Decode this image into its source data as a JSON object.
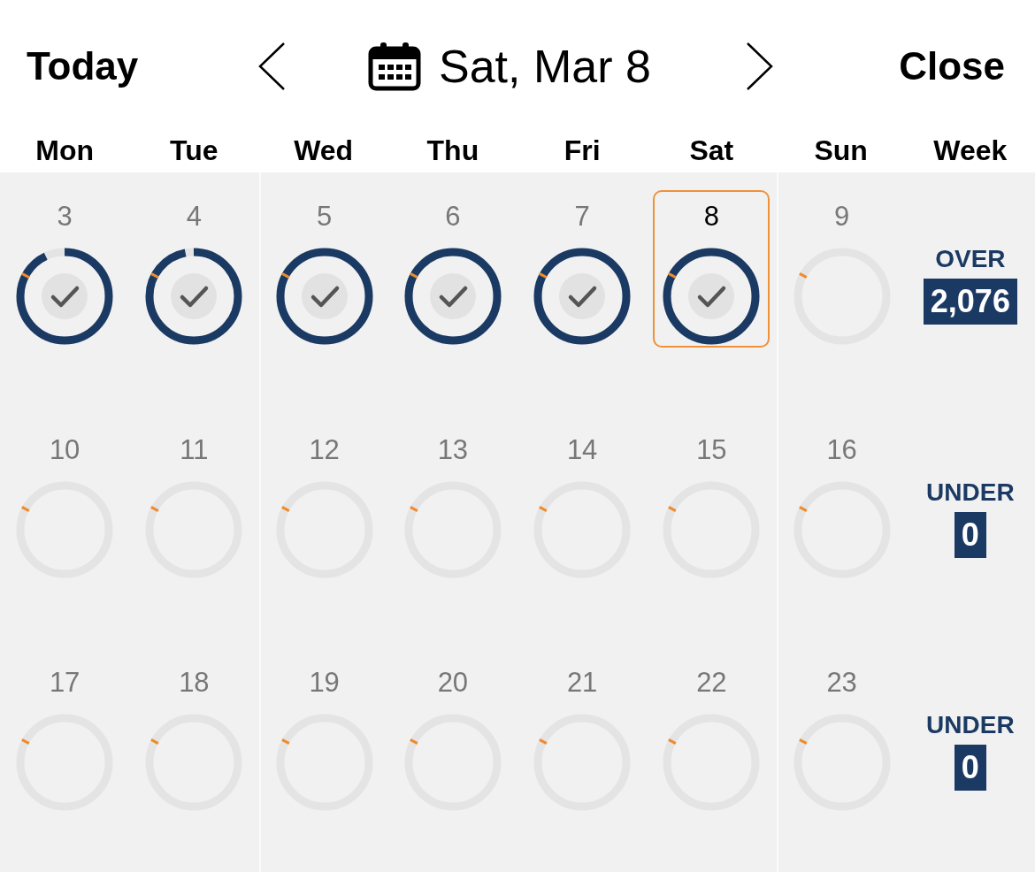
{
  "header": {
    "today_button": "Today",
    "date": "Sat, Mar 8",
    "close_button": "Close"
  },
  "weekdays": [
    "Mon",
    "Tue",
    "Wed",
    "Thu",
    "Fri",
    "Sat",
    "Sun",
    "Week"
  ],
  "weeks": [
    {
      "days": [
        {
          "number": "3",
          "level": 0.93,
          "done": true,
          "selected": false
        },
        {
          "number": "4",
          "level": 0.97,
          "done": true,
          "selected": false
        },
        {
          "number": "5",
          "level": 1,
          "done": true,
          "selected": false
        },
        {
          "number": "6",
          "level": 1,
          "done": true,
          "selected": false
        },
        {
          "number": "7",
          "level": 1,
          "done": true,
          "selected": false
        },
        {
          "number": "8",
          "level": 1,
          "done": true,
          "selected": true
        },
        {
          "number": "9",
          "level": 0,
          "done": false,
          "selected": false
        }
      ],
      "summary": {
        "label": "OVER",
        "value": "2,076"
      }
    },
    {
      "days": [
        {
          "number": "10",
          "level": 0,
          "done": false,
          "selected": false
        },
        {
          "number": "11",
          "level": 0,
          "done": false,
          "selected": false
        },
        {
          "number": "12",
          "level": 0,
          "done": false,
          "selected": false
        },
        {
          "number": "13",
          "level": 0,
          "done": false,
          "selected": false
        },
        {
          "number": "14",
          "level": 0,
          "done": false,
          "selected": false
        },
        {
          "number": "15",
          "level": 0,
          "done": false,
          "selected": false
        },
        {
          "number": "16",
          "level": 0,
          "done": false,
          "selected": false
        }
      ],
      "summary": {
        "label": "UNDER",
        "value": "0"
      }
    },
    {
      "days": [
        {
          "number": "17",
          "level": 0,
          "done": false,
          "selected": false
        },
        {
          "number": "18",
          "level": 0,
          "done": false,
          "selected": false
        },
        {
          "number": "19",
          "level": 0,
          "done": false,
          "selected": false
        },
        {
          "number": "20",
          "level": 0,
          "done": false,
          "selected": false
        },
        {
          "number": "21",
          "level": 0,
          "done": false,
          "selected": false
        },
        {
          "number": "22",
          "level": 0,
          "done": false,
          "selected": false
        },
        {
          "number": "23",
          "level": 0,
          "done": false,
          "selected": false
        }
      ],
      "summary": {
        "label": "UNDER",
        "value": "0"
      }
    }
  ]
}
